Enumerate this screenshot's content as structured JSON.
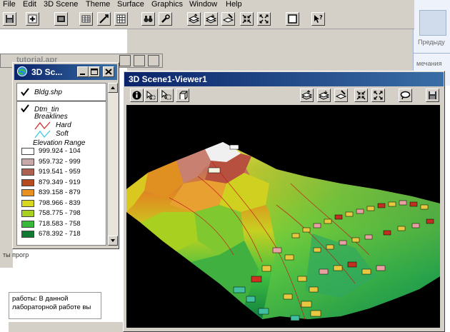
{
  "menubar": {
    "items": [
      "File",
      "Edit",
      "3D Scene",
      "Theme",
      "Surface",
      "Graphics",
      "Window",
      "Help"
    ]
  },
  "toolbar": {
    "icons": [
      "save-icon",
      "add-theme-icon",
      "view-icon",
      "table-icon",
      "pan-icon",
      "grid-icon",
      "binoculars-icon",
      "wrench-icon",
      "layer-up-icon",
      "layer-down-icon",
      "pin-layer-icon",
      "zoom-in-icon",
      "zoom-out-icon",
      "window-icon",
      "help-pointer-icon"
    ]
  },
  "background_doc": {
    "side_label_1": "Предыду",
    "side_label_2": "мечания",
    "body_text": "работы: В данной лабораторной работе вы",
    "bg_window_title": "tutorial.apr",
    "bg_left_label": "ты прогр"
  },
  "legend_window": {
    "title": "3D Sc...",
    "layers": [
      {
        "name": "Bldg.shp",
        "checked": true
      },
      {
        "name": "Dtm_tin",
        "checked": true
      }
    ],
    "breaklines_label": "Breaklines",
    "breaklines": [
      {
        "name": "Hard",
        "color": "#d03030"
      },
      {
        "name": "Soft",
        "color": "#40c8e0"
      }
    ],
    "elevation_label": "Elevation Range",
    "ranges": [
      {
        "label": "999.924 - 104",
        "color": "#ffffff"
      },
      {
        "label": "959.732 - 999",
        "color": "#c8a8a8"
      },
      {
        "label": "919.541 - 959",
        "color": "#b06050"
      },
      {
        "label": "879.349 - 919",
        "color": "#b84a20"
      },
      {
        "label": "839.158 - 879",
        "color": "#e89020"
      },
      {
        "label": "798.966 - 839",
        "color": "#d8d820"
      },
      {
        "label": "758.775 - 798",
        "color": "#a8d020"
      },
      {
        "label": "718.583 - 758",
        "color": "#38b838"
      },
      {
        "label": "678.392 - 718",
        "color": "#107830"
      }
    ]
  },
  "viewer": {
    "title": "3D Scene1-Viewer1",
    "left_tools": [
      "identify-icon",
      "select-icon",
      "select-graphics-icon",
      "navigate-icon"
    ],
    "right_tools": [
      "layer-up-icon",
      "layer-down-icon",
      "pin-layer-icon",
      "zoom-in-icon",
      "zoom-out-icon",
      "rotate-icon",
      "save-icon"
    ]
  },
  "colors": {
    "titlebar_active": "#0a246a",
    "face": "#d4d0c8"
  }
}
